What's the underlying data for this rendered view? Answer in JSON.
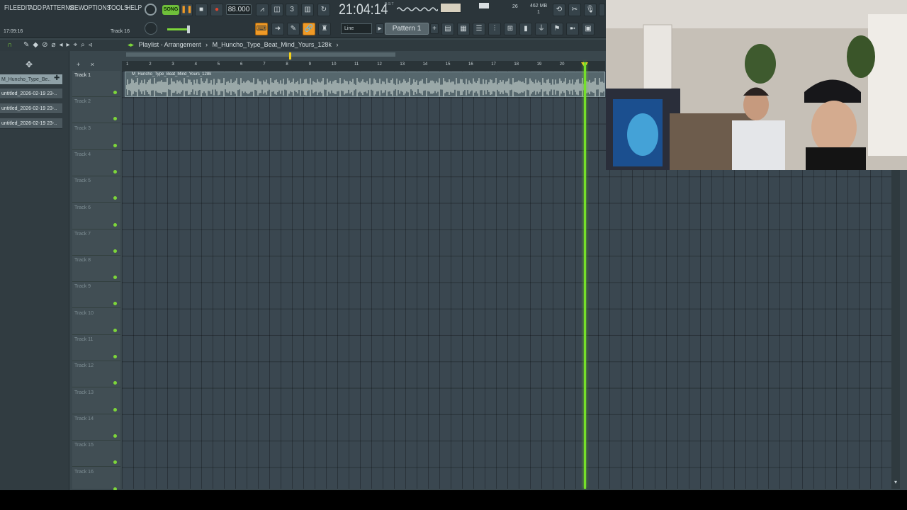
{
  "menu": [
    "FILE",
    "EDIT",
    "ADD",
    "PATTERNS",
    "VIEW",
    "OPTIONS",
    "TOOLS",
    "HELP"
  ],
  "transport": {
    "mode": "SONG",
    "tempo": "88.000",
    "clock": "21:04:14",
    "clock_sub": "B:S:T",
    "position": "17:09:16",
    "focused_track": "Track 16"
  },
  "system": {
    "cpu": "26",
    "memory": "462 MB",
    "polyphony": "1"
  },
  "snap": "Line",
  "pattern": "Pattern 1",
  "playlist": {
    "title": "Playlist - Arrangement",
    "file": "M_Huncho_Type_Beat_Mind_Yours_128k"
  },
  "clips": [
    "M_Huncho_Type_Be..",
    "untitled_2026-02-19 23-..",
    "untitled_2026-02-19 23-..",
    "untitled_2026-02-19 23-.."
  ],
  "tracks": [
    "Track 1",
    "Track 2",
    "Track 3",
    "Track 4",
    "Track 5",
    "Track 6",
    "Track 7",
    "Track 8",
    "Track 9",
    "Track 10",
    "Track 11",
    "Track 12",
    "Track 13",
    "Track 14",
    "Track 15",
    "Track 16"
  ],
  "bars": [
    "1",
    "2",
    "3",
    "4",
    "5",
    "6",
    "7",
    "8",
    "9",
    "10",
    "11",
    "12",
    "13",
    "14",
    "15",
    "16",
    "17",
    "18",
    "19",
    "20",
    "21"
  ],
  "audio_clip_label": "M_Huncho_Type_Beat_Mind_Yours_128k",
  "colors": {
    "accent": "#f09a26",
    "playhead": "#76e02a",
    "song_mode": "#6fbf3a",
    "marker": "#f4d21a"
  },
  "playhead_bar": 21
}
